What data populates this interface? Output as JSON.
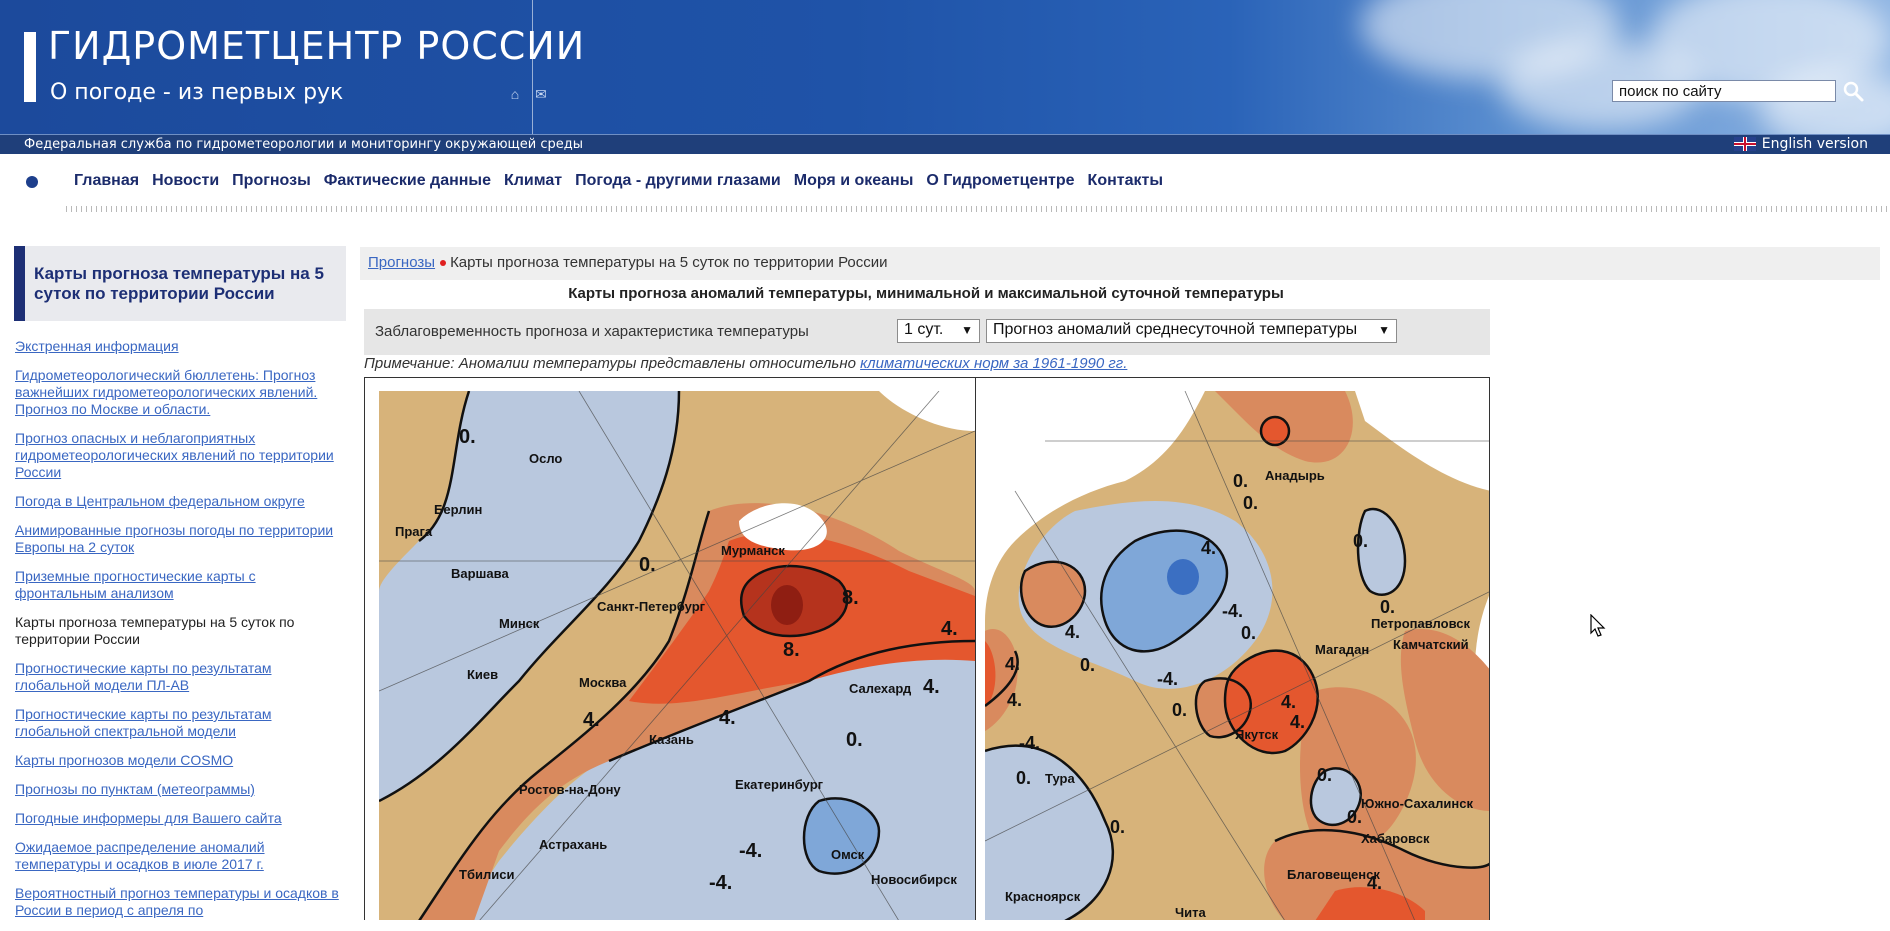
{
  "header": {
    "title": "ГИДРОМЕТЦЕНТР РОССИИ",
    "subtitle": "О погоде - из первых рук",
    "search_value": "поиск по сайту",
    "agency": "Федеральная служба по гидрометеорологии и мониторингу окружающей среды",
    "english_label": "English version"
  },
  "nav": {
    "items": [
      "Главная",
      "Новости",
      "Прогнозы",
      "Фактические данные",
      "Климат",
      "Погода - другими глазами",
      "Моря и океаны",
      "О Гидрометцентре",
      "Контакты"
    ]
  },
  "sidebar": {
    "title": "Карты прогноза температуры на 5 суток по территории России",
    "links": [
      {
        "label": "Экстренная информация",
        "current": false
      },
      {
        "label": "Гидрометеорологический бюллетень: Прогноз важнейших гидрометеорологических явлений. Прогноз по Москве и области.",
        "current": false
      },
      {
        "label": "Прогноз опасных и неблагоприятных гидрометеорологических явлений по территории России",
        "current": false
      },
      {
        "label": "Погода в Центральном федеральном округе",
        "current": false
      },
      {
        "label": "Анимированные прогнозы погоды по территории Европы на 2 суток",
        "current": false
      },
      {
        "label": "Приземные прогностические карты с фронтальным анализом",
        "current": false
      },
      {
        "label": "Карты прогноза температуры на 5 суток по территории России",
        "current": true
      },
      {
        "label": "Прогностические карты по результатам глобальной модели ПЛ-АВ",
        "current": false
      },
      {
        "label": "Прогностические карты по результатам глобальной спектральной модели",
        "current": false
      },
      {
        "label": "Карты прогнозов модели COSMO",
        "current": false
      },
      {
        "label": "Прогнозы по пунктам (метеограммы)",
        "current": false
      },
      {
        "label": "Погодные информеры для Вашего сайта",
        "current": false
      },
      {
        "label": "Ожидаемое распределение аномалий температуры и осадков в июле 2017 г.",
        "current": false
      },
      {
        "label": "Вероятностный прогноз температуры и осадков в России в период с апреля по",
        "current": false
      }
    ]
  },
  "breadcrumb": {
    "parent": "Прогнозы",
    "current": "Карты прогноза температуры на 5 суток по территории России"
  },
  "main": {
    "heading": "Карты прогноза аномалий температуры, минимальной и максимальной суточной температуры",
    "control_label": "Заблаговременность прогноза и характеристика температуры",
    "lead_time": "1 сут.",
    "temp_type": "Прогноз аномалий среднесуточной температуры",
    "note_prefix": "Примечание: Аномалии температуры представлены относительно ",
    "note_link": "климатических норм за 1961-1990 гг."
  },
  "map_west": {
    "cities": [
      "Осло",
      "Берлин",
      "Прага",
      "Варшава",
      "Минск",
      "Киев",
      "Мурманск",
      "Санкт-Петербург",
      "Москва",
      "Салехард",
      "Казань",
      "Ростов-на-Дону",
      "Екатеринбург",
      "Астрахань",
      "Омск",
      "Тбилиси",
      "Новосибирск"
    ],
    "labels": [
      "0.",
      "0.",
      "8.",
      "8.",
      "4.",
      "4.",
      "4.",
      "0.",
      "4.",
      "-4.",
      "-4."
    ]
  },
  "map_east": {
    "cities": [
      "Анадырь",
      "Петропавловск",
      "Камчатский",
      "Магадан",
      "Якутск",
      "Тура",
      "Южно-Сахалинск",
      "Хабаровск",
      "Благовещенск",
      "Красноярск",
      "Чита"
    ],
    "labels": [
      "0.",
      "0.",
      "0.",
      "0.",
      "4.",
      "-4.",
      "0.",
      "-4.",
      "4.",
      "4.",
      "0.",
      "4.",
      "-4.",
      "0.",
      "0.",
      "4.",
      "0.",
      "0.",
      "0.",
      "4."
    ]
  },
  "colors": {
    "header_blue": "#1f53a8",
    "nav_text": "#1b2b6b",
    "link": "#3a67c2",
    "anom_cold_dark": "#7fa7d8",
    "anom_cold": "#b9c8de",
    "anom_neutral": "#d7b37a",
    "anom_warm": "#d98a5e",
    "anom_hot": "#e4572e",
    "anom_very_hot": "#b5331d"
  }
}
